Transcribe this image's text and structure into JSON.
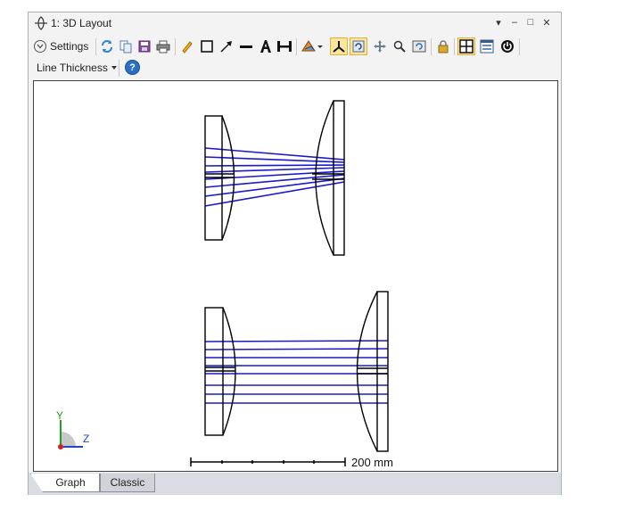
{
  "window": {
    "title": "1: 3D Layout",
    "controls": {
      "dropdown": "▾",
      "minimize": "–",
      "maximize": "□",
      "close": "✕"
    }
  },
  "toolbar": {
    "settings_label": "Settings",
    "line_thickness_label": "Line Thickness",
    "help_label": "?"
  },
  "plot": {
    "scale_bar_label": "200 mm",
    "axis_labels": {
      "y": "Y",
      "z": "Z"
    }
  },
  "tabs": [
    {
      "label": "Graph",
      "active": true
    },
    {
      "label": "Classic",
      "active": false
    }
  ],
  "colors": {
    "ray": "#1a1acc",
    "lens_outline": "#000000",
    "axis_y": "#22a022",
    "axis_z": "#2244cc",
    "axis_x": "#cc2222",
    "active_tool": "#fbe69d"
  }
}
